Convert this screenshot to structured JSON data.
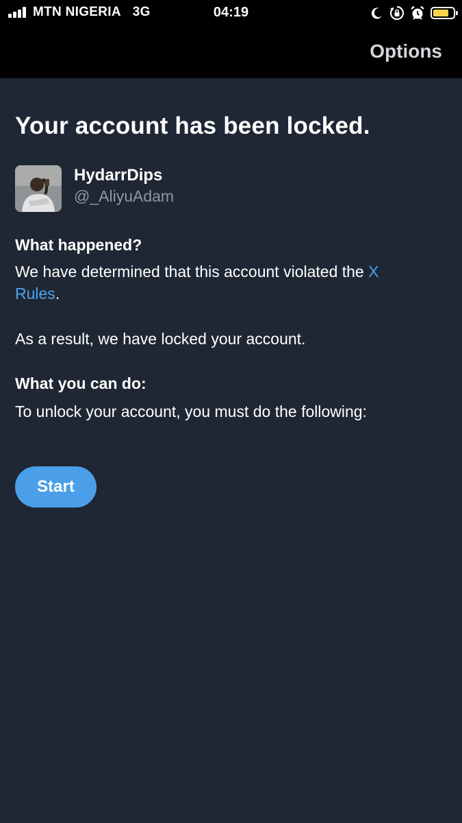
{
  "status_bar": {
    "carrier": "MTN NIGERIA",
    "network": "3G",
    "time": "04:19",
    "signal_bars": 4,
    "battery_level": 0.8,
    "battery_color": "#f7d34a",
    "icons": [
      "moon-icon",
      "orientation-lock-icon",
      "alarm-icon",
      "battery-icon"
    ]
  },
  "nav": {
    "options_label": "Options"
  },
  "page": {
    "title": "Your account has been locked."
  },
  "account": {
    "display_name": "HydarrDips",
    "handle": "@_AliyuAdam"
  },
  "sections": {
    "what_happened_heading": "What happened?",
    "violation_text_before": "We have determined that this account violated the ",
    "rules_link": "X Rules",
    "violation_text_after": ".",
    "result_text": "As a result, we have locked your account.",
    "what_you_can_do_heading": "What you can do:",
    "unlock_text": "To unlock your account, you must do the following:"
  },
  "actions": {
    "start_label": "Start"
  },
  "colors": {
    "background": "#1f2734",
    "link": "#4aa3f0",
    "button": "#4a9fe8",
    "secondary_text": "#8b98a5"
  }
}
